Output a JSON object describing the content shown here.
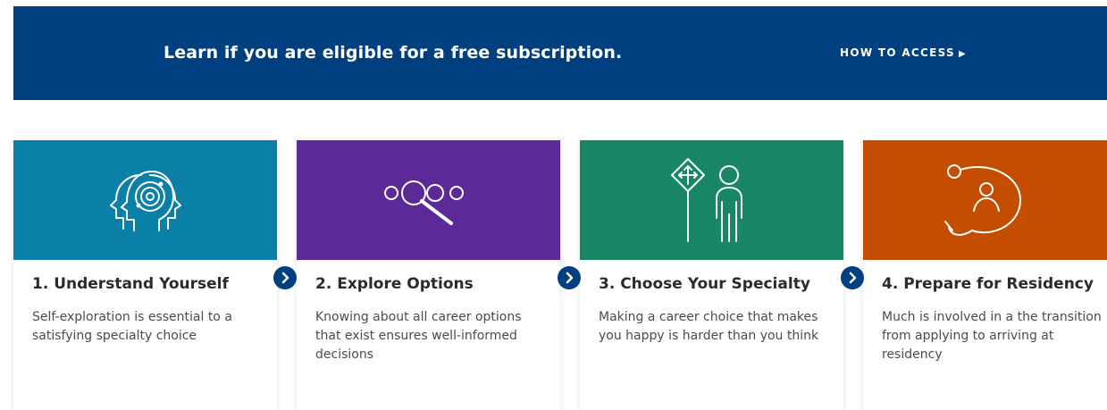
{
  "banner": {
    "text": "Learn if you are eligible for a free subscription.",
    "link_label": "HOW TO ACCESS",
    "background": "#003f80"
  },
  "cards": [
    {
      "title": "1. Understand Yourself",
      "description": "Self-exploration is essential to a satisfying specialty choice",
      "color": "#0a80a8",
      "icon": "head-profiles-target-icon"
    },
    {
      "title": "2. Explore Options",
      "description": "Knowing about all career options that exist ensures well-informed decisions",
      "color": "#5b2a96",
      "icon": "magnifying-glass-circles-icon"
    },
    {
      "title": "3. Choose Your Specialty",
      "description": "Making a career choice that makes you happy is harder than you think",
      "color": "#188766",
      "icon": "person-signpost-icon"
    },
    {
      "title": "4. Prepare for Residency",
      "description": "Much is involved in a the transition from applying to arriving at residency",
      "color": "#c44d00",
      "icon": "person-path-icon"
    }
  ],
  "step_arrow_color": "#003f80"
}
